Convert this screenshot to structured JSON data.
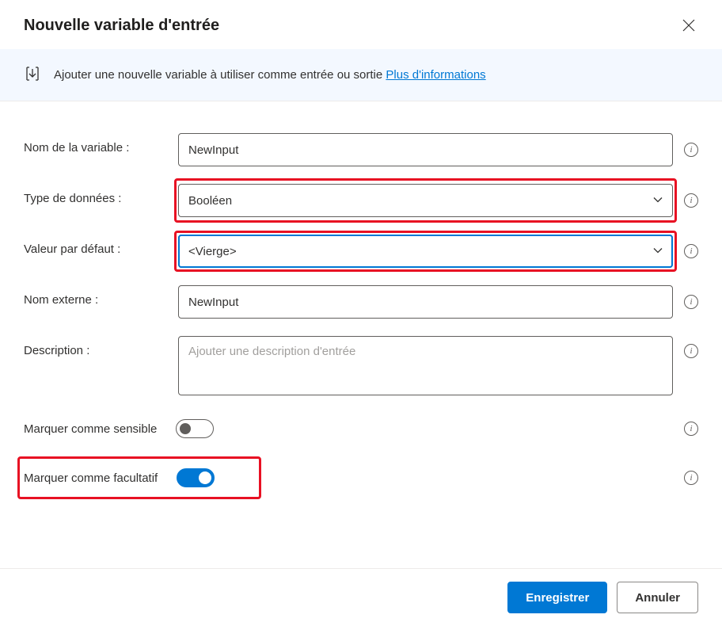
{
  "dialog": {
    "title": "Nouvelle variable d'entrée"
  },
  "banner": {
    "text": "Ajouter une nouvelle variable à utiliser comme entrée ou sortie ",
    "link": "Plus d'informations"
  },
  "fields": {
    "variable_name": {
      "label": "Nom de la variable :",
      "value": "NewInput"
    },
    "data_type": {
      "label": "Type de données :",
      "value": "Booléen"
    },
    "default_value": {
      "label": "Valeur par défaut :",
      "value": "<Vierge>"
    },
    "external_name": {
      "label": "Nom externe :",
      "value": "NewInput"
    },
    "description": {
      "label": "Description :",
      "placeholder": "Ajouter une description d'entrée"
    },
    "mark_sensitive": {
      "label": "Marquer comme sensible",
      "value": false
    },
    "mark_optional": {
      "label": "Marquer comme facultatif",
      "value": true
    }
  },
  "footer": {
    "save": "Enregistrer",
    "cancel": "Annuler"
  }
}
